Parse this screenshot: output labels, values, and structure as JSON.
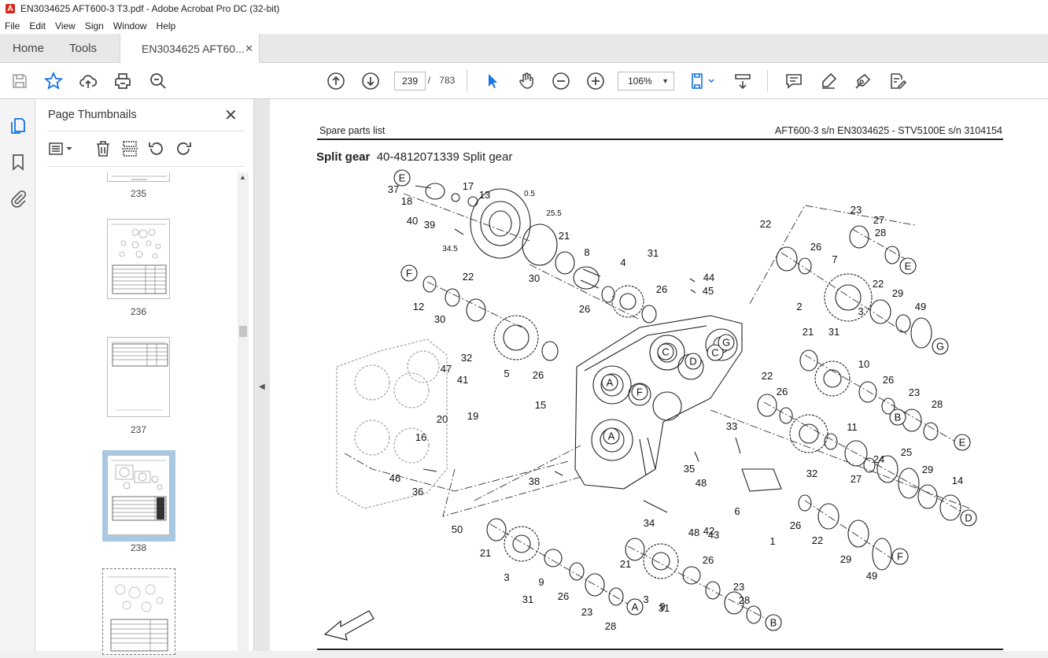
{
  "window": {
    "title": "EN3034625 AFT600-3 T3.pdf - Adobe Acrobat Pro DC (32-bit)"
  },
  "menu": [
    "File",
    "Edit",
    "View",
    "Sign",
    "Window",
    "Help"
  ],
  "tabs": {
    "home": "Home",
    "tools": "Tools",
    "document": "EN3034625 AFT60..."
  },
  "toolbar": {
    "current_page": "239",
    "page_separator": "/",
    "total_pages": "783",
    "zoom": "106%"
  },
  "thumbnails": {
    "title": "Page Thumbnails",
    "pages": [
      {
        "label": "235",
        "selected": false
      },
      {
        "label": "236",
        "selected": false
      },
      {
        "label": "237",
        "selected": false
      },
      {
        "label": "238",
        "selected": true
      },
      {
        "label": "",
        "selected": false
      }
    ]
  },
  "document": {
    "header_left": "Spare parts list",
    "header_right": "AFT600-3 s/n EN3034625 - STV5100E s/n 3104154",
    "title_bold": "Split gear",
    "title_rest": "40-4812071339 Split gear",
    "diagram_callouts": [
      "37",
      "18",
      "40",
      "39",
      "17",
      "13",
      "0.5",
      "25.5",
      "34.5",
      "30",
      "21",
      "8",
      "31",
      "44",
      "45",
      "12",
      "22",
      "30",
      "4",
      "26",
      "26",
      "5",
      "32",
      "26",
      "47",
      "41",
      "19",
      "16",
      "15",
      "20",
      "46",
      "36",
      "50",
      "21",
      "3",
      "9",
      "31",
      "26",
      "23",
      "28",
      "21",
      "3",
      "9",
      "26",
      "23",
      "28",
      "31",
      "38",
      "35",
      "34",
      "33",
      "48",
      "48",
      "42",
      "43",
      "6",
      "1",
      "32",
      "11",
      "27",
      "24",
      "25",
      "29",
      "14",
      "26",
      "22",
      "29",
      "49",
      "10",
      "26",
      "23",
      "28",
      "22",
      "26",
      "21",
      "31",
      "3",
      "23",
      "27",
      "28",
      "22",
      "26",
      "7",
      "2",
      "22",
      "29",
      "49"
    ],
    "letter_markers": [
      "E",
      "F",
      "E",
      "G",
      "C",
      "D",
      "A",
      "F",
      "C",
      "G",
      "E",
      "D",
      "A",
      "B",
      "A",
      "B",
      "F"
    ]
  },
  "colors": {
    "accent": "#1473e6",
    "selected_thumb": "#a9c9e3",
    "app_red": "#d7251d"
  }
}
